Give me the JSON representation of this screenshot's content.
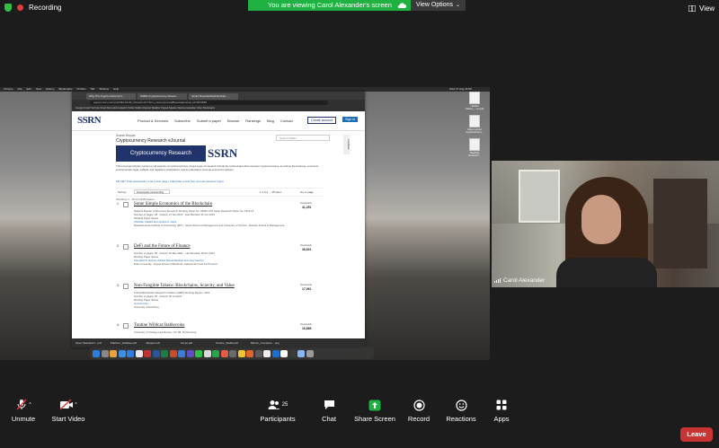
{
  "topbar": {
    "recording": "Recording",
    "banner_text": "You are viewing Carol Alexander's screen",
    "view_options": "View Options",
    "view": "View"
  },
  "shared_screen": {
    "menubar": [
      "Chrome",
      "File",
      "Edit",
      "View",
      "History",
      "Bookmarks",
      "Profiles",
      "Tab",
      "Window",
      "Help"
    ],
    "clock": "Wed 27 Aug 16:59",
    "tabs": [
      "Why The Crypto Craze Isn't...",
      "SSRN Cryptocurrency Resear...",
      "Junior Decentralized Exchan..."
    ],
    "url": "papers.ssrn.com/sol3/JELJOUR_Results.cfm?form_name=journalBrowse&journal_id=3872865",
    "bookmarks": "Google  Gmail  YouTube  Smart Moneylink  LinkedIn  Twitter  Netflix  Channel  Weather  Paypal  Squarex  Marcus  Guardian  Other Bookmarks",
    "ssrn": {
      "logo": "SSRN",
      "nav": [
        "Product & Services",
        "Subscribe",
        "Submit a paper",
        "Browse",
        "Rankings",
        "Blog",
        "Contact"
      ],
      "create_account": "Create account",
      "sign_in": "Sign in",
      "breadcrumb": "Search Results",
      "title": "Cryptocurrency Research eJournal",
      "search_placeholder": "Search SSRN",
      "feedback": "Feedback",
      "banner": "Cryptocurrency Research",
      "banner_logo": "SSRN",
      "description": "This eJournal includes content on all aspects of cryptocurrencies, broad areas of research include the technologies that empower cryptocurrencies, as well as the business, economic, environmental, legal, political, and regulatory implications, and its potential to promote economic inclusion.",
      "stats": "184,097 Total downloads  |  Link to this page  |  Subscribe to this free Journal  (requires login)",
      "sort_label": "Sort by",
      "sort_value": "Downloads, Descending",
      "pager": "1  2  3  4  ...  25    Next",
      "goto": "Go to page",
      "showing": "Showing: 1 - 40 of 3,048 papers",
      "papers": [
        {
          "num": "1.",
          "title": "Some Simple Economics of the Blockchain",
          "meta": "National Bureau of Economic Research Working Paper No. 22952; MIT Sloan Research Paper No. 5191-16",
          "meta2": "Number of pages: 38  ·  Posted: 27 Jan 2016  ·  Last Revised: 26 Jun 2019",
          "meta3": "Working Paper Series",
          "authors": "Christian Catalini and Joshua S. Gans",
          "affil": "Massachusetts Institute of Technology (MIT) - Sloan School of Management and University of Toronto - Rotman School of Management",
          "dl_label": "Downloads",
          "downloads": "41,251"
        },
        {
          "num": "2.",
          "title": "DeFi and the Future of Finance",
          "meta": "Number of pages: 92  ·  Posted: 10 Mar 2021  ·  Last Revised: 06 Apr 2021",
          "meta2": "Working Paper Series",
          "meta3": "",
          "authors": "Campbell R. Harvey, Ashwin Ramachandran and Joey Santoro",
          "affil": "Duke University - Fuqua School of Business, Independent and Fei Protocol",
          "dl_label": "Downloads",
          "downloads": "38,631"
        },
        {
          "num": "3.",
          "title": "Non-Fungible Tokens: Blockchains, Scarcity, and Value",
          "meta": "Critical Blockchain Research Initiative (CBRI) Working Papers, 2021",
          "meta2": "Number of pages: 25  ·  Posted: 25 Jul 2021",
          "meta3": "Working Paper Series",
          "authors": "Lennart Ante",
          "affil": "University of Hamburg",
          "dl_label": "Downloads",
          "downloads": "17,061"
        },
        {
          "num": "4.",
          "title": "Tontine Wildcat Stablecoins",
          "meta": "University of Chicago Law Review, Vol. 88, Forthcoming",
          "meta2": "",
          "meta3": "",
          "authors": "",
          "affil": "",
          "dl_label": "Downloads",
          "downloads": "16,889"
        }
      ]
    },
    "downloads_bar": [
      "Open Standard f...pdf",
      "Platform_Initiative.pdf",
      "nftpaper.pdf",
      "lumps.pdf",
      "Tontine_Stable.pdf",
      "Bitcoin_Complete....png"
    ],
    "desktop_icons": [
      "Untitled Partner_...ent.pdf",
      "Video Lecture Cryptocurrency...",
      "Teaching Research..."
    ]
  },
  "speaker": {
    "name": "Carol Alexander"
  },
  "toolbar": {
    "unmute": "Unmute",
    "start_video": "Start Video",
    "participants": "Participants",
    "participants_count": "25",
    "chat": "Chat",
    "share_screen": "Share Screen",
    "record": "Record",
    "reactions": "Reactions",
    "apps": "Apps",
    "leave": "Leave"
  },
  "colors": {
    "banner_green": "#1fb141",
    "leave_red": "#c93535",
    "ssrn_navy": "#20336b",
    "share_green": "#1fb141"
  }
}
